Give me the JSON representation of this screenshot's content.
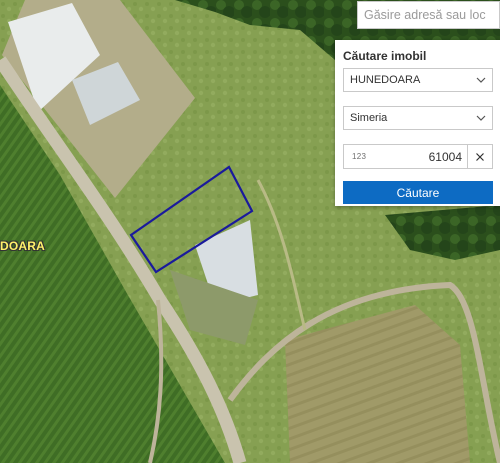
{
  "search": {
    "placeholder": "Găsire adresă sau loc"
  },
  "panel": {
    "title": "Căutare imobil",
    "county": "HUNEDOARA",
    "locality": "Simeria",
    "id_icon": "123",
    "id_value": "61004",
    "submit_label": "Căutare"
  },
  "map": {
    "place_label": "DOARA",
    "parcel_outline_color": "#1a1a9c",
    "label_color": "#fff16a"
  },
  "colors": {
    "accent": "#0d6bc3"
  },
  "icons": {
    "dropdown": "chevron-down-icon",
    "clear": "close-icon"
  }
}
